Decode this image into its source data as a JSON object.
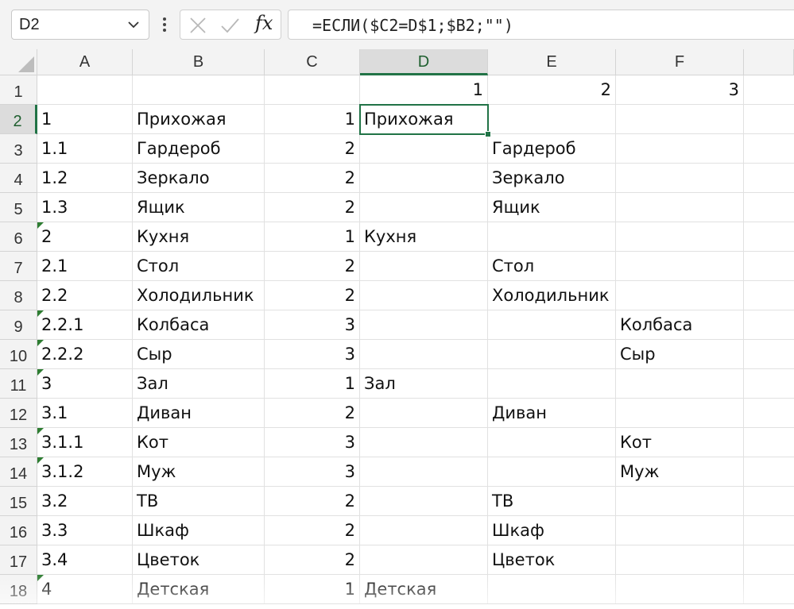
{
  "formula_bar": {
    "name_box": "D2",
    "formula": "=ЕСЛИ($C2=D$1;$B2;\"\")",
    "fx_label": "fx"
  },
  "columns": [
    "A",
    "B",
    "C",
    "D",
    "E",
    "F"
  ],
  "selected_cell": "D2",
  "rows": [
    {
      "num": "1",
      "a": "",
      "b": "",
      "c": "",
      "d": "1",
      "e": "2",
      "f": "3"
    },
    {
      "num": "2",
      "a": "1",
      "b": "Прихожая",
      "c": "1",
      "d": "Прихожая",
      "e": "",
      "f": ""
    },
    {
      "num": "3",
      "a": "1.1",
      "b": "Гардероб",
      "c": "2",
      "d": "",
      "e": "Гардероб",
      "f": ""
    },
    {
      "num": "4",
      "a": "1.2",
      "b": "Зеркало",
      "c": "2",
      "d": "",
      "e": "Зеркало",
      "f": ""
    },
    {
      "num": "5",
      "a": "1.3",
      "b": "Ящик",
      "c": "2",
      "d": "",
      "e": "Ящик",
      "f": ""
    },
    {
      "num": "6",
      "a": "2",
      "b": "Кухня",
      "c": "1",
      "d": "Кухня",
      "e": "",
      "f": ""
    },
    {
      "num": "7",
      "a": "2.1",
      "b": "Стол",
      "c": "2",
      "d": "",
      "e": "Стол",
      "f": ""
    },
    {
      "num": "8",
      "a": "2.2",
      "b": "Холодильник",
      "c": "2",
      "d": "",
      "e": "Холодильник",
      "f": ""
    },
    {
      "num": "9",
      "a": "2.2.1",
      "b": "Колбаса",
      "c": "3",
      "d": "",
      "e": "",
      "f": "Колбаса"
    },
    {
      "num": "10",
      "a": "2.2.2",
      "b": "Сыр",
      "c": "3",
      "d": "",
      "e": "",
      "f": "Сыр"
    },
    {
      "num": "11",
      "a": "3",
      "b": "Зал",
      "c": "1",
      "d": "Зал",
      "e": "",
      "f": ""
    },
    {
      "num": "12",
      "a": "3.1",
      "b": "Диван",
      "c": "2",
      "d": "",
      "e": "Диван",
      "f": ""
    },
    {
      "num": "13",
      "a": "3.1.1",
      "b": "Кот",
      "c": "3",
      "d": "",
      "e": "",
      "f": "Кот"
    },
    {
      "num": "14",
      "a": "3.1.2",
      "b": "Муж",
      "c": "3",
      "d": "",
      "e": "",
      "f": "Муж"
    },
    {
      "num": "15",
      "a": "3.2",
      "b": "ТВ",
      "c": "2",
      "d": "",
      "e": "ТВ",
      "f": ""
    },
    {
      "num": "16",
      "a": "3.3",
      "b": "Шкаф",
      "c": "2",
      "d": "",
      "e": "Шкаф",
      "f": ""
    },
    {
      "num": "17",
      "a": "3.4",
      "b": "Цветок",
      "c": "2",
      "d": "",
      "e": "Цветок",
      "f": ""
    },
    {
      "num": "18",
      "a": "4",
      "b": "Детская",
      "c": "1",
      "d": "Детская",
      "e": "",
      "f": ""
    }
  ],
  "text_as_number_flag_rows": [
    "6",
    "9",
    "10",
    "11",
    "13",
    "14",
    "18"
  ],
  "accent_color": "#217346",
  "icons": [
    "chevron-down-icon",
    "more-vert-icon",
    "cancel-x-icon",
    "enter-check-icon",
    "select-all-triangle-icon"
  ]
}
